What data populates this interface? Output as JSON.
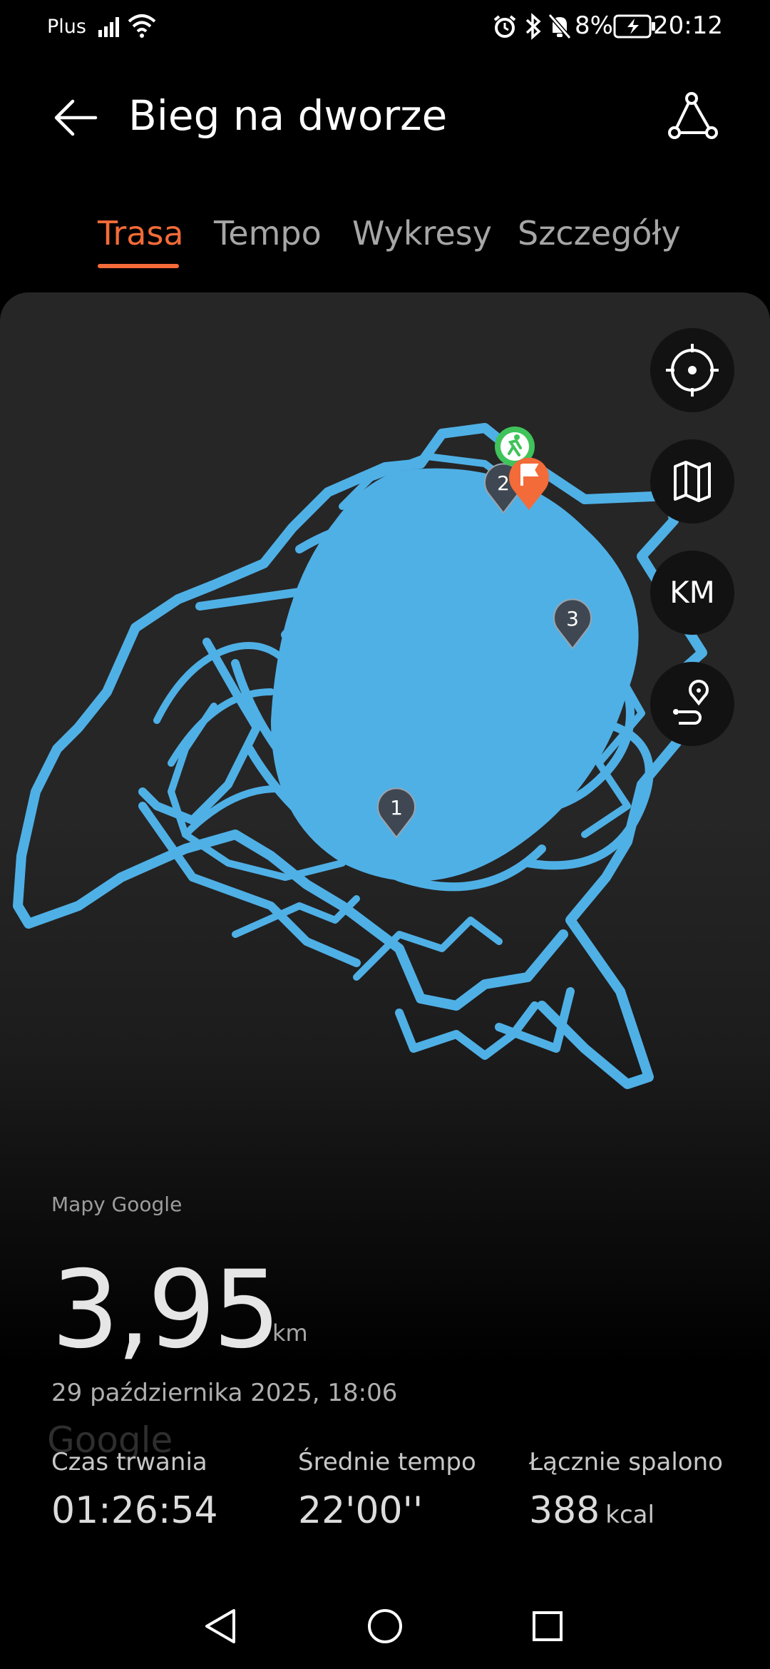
{
  "status_bar": {
    "carrier": "Plus",
    "battery_percent": "8%",
    "time": "20:12",
    "icons": [
      "signal-icon",
      "wifi-icon",
      "alarm-icon",
      "bluetooth-icon",
      "bell-muted-icon",
      "battery-charging-icon"
    ]
  },
  "header": {
    "title": "Bieg na dworze",
    "back_icon": "back-arrow-icon",
    "share_icon": "route-share-icon"
  },
  "tabs": [
    {
      "label": "Trasa",
      "active": true
    },
    {
      "label": "Tempo",
      "active": false
    },
    {
      "label": "Wykresy",
      "active": false
    },
    {
      "label": "Szczegóły",
      "active": false
    }
  ],
  "map": {
    "route_color": "#4fb0e6",
    "km_markers": [
      "1",
      "2",
      "3"
    ],
    "controls": {
      "locate_icon": "locate-target-icon",
      "map_type_icon": "map-icon",
      "unit_label": "KM",
      "route_icon": "route-pin-icon"
    },
    "attribution": "Mapy Google",
    "watermark": "Google"
  },
  "summary": {
    "distance": "3,95",
    "distance_unit": "km",
    "date": "29 października 2025, 18:06",
    "stats": [
      {
        "label": "Czas trwania",
        "value": "01:26:54",
        "unit": ""
      },
      {
        "label": "Średnie tempo",
        "value": "22'00''",
        "unit": ""
      },
      {
        "label": "Łącznie spalono",
        "value": "388",
        "unit": "kcal"
      }
    ]
  },
  "nav": {
    "back_icon": "nav-back-icon",
    "home_icon": "nav-home-icon",
    "recents_icon": "nav-recents-icon"
  },
  "colors": {
    "accent": "#f36b38",
    "route": "#4fb0e6",
    "start_marker": "#3fc35a",
    "background": "#000000"
  }
}
